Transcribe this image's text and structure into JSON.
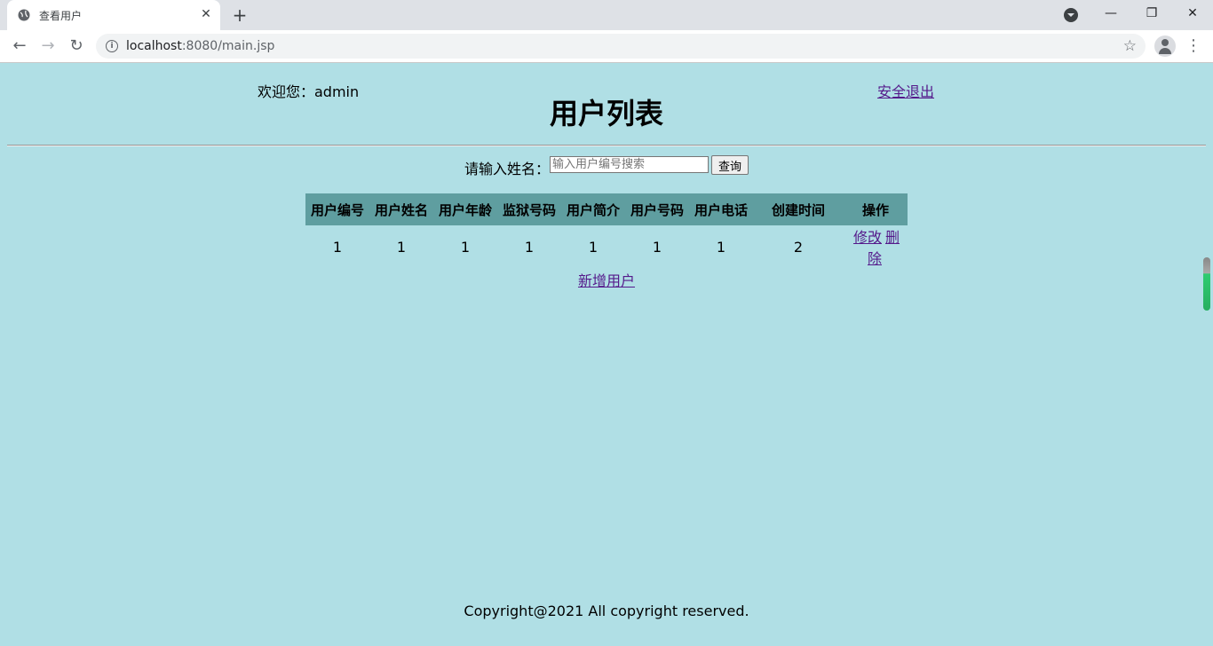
{
  "browser": {
    "tab_title": "查看用户",
    "tab_close": "✕",
    "new_tab": "+",
    "window_controls": {
      "minimize": "—",
      "restore": "❐",
      "close": "✕"
    },
    "nav": {
      "back": "←",
      "forward": "→",
      "reload": "↻"
    },
    "url_host": "localhost",
    "url_path": ":8080/main.jsp",
    "bookmark_icon": "☆",
    "menu_icon": "⋮"
  },
  "header": {
    "welcome": "欢迎您：admin",
    "title": "用户列表",
    "logout": "安全退出"
  },
  "search": {
    "label": "请输入姓名：",
    "placeholder": "输入用户编号搜索",
    "button": "查询"
  },
  "table": {
    "headers": [
      "用户编号",
      "用户姓名",
      "用户年龄",
      "监狱号码",
      "用户简介",
      "用户号码",
      "用户电话",
      "创建时间",
      "操作"
    ],
    "rows": [
      {
        "cells": [
          "1",
          "1",
          "1",
          "1",
          "1",
          "1",
          "1",
          "2"
        ],
        "edit": "修改",
        "delete": "删除"
      }
    ]
  },
  "add_user": "新增用户",
  "footer": "Copyright@2021 All copyright reserved."
}
